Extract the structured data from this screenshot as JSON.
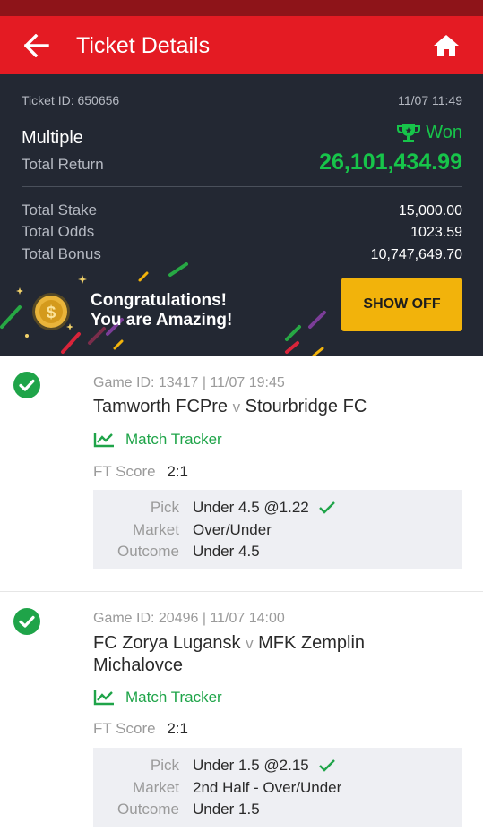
{
  "header": {
    "title": "Ticket Details"
  },
  "ticket": {
    "id_label": "Ticket ID: 650656",
    "datetime": "11/07 11:49",
    "bet_type": "Multiple",
    "status": "Won",
    "total_return_label": "Total Return",
    "total_return": "26,101,434.99",
    "stats": [
      {
        "label": "Total Stake",
        "value": "15,000.00"
      },
      {
        "label": "Total Odds",
        "value": "1023.59"
      },
      {
        "label": "Total Bonus",
        "value": "10,747,649.70"
      }
    ]
  },
  "banner": {
    "line1": "Congratulations!",
    "line2": "You are Amazing!",
    "button_label": "SHOW OFF"
  },
  "games": [
    {
      "meta": "Game ID: 13417 | 11/07 19:45",
      "home": "Tamworth FCPre",
      "vs": "v",
      "away": "Stourbridge FC",
      "tracker_label": "Match Tracker",
      "ft_label": "FT Score",
      "ft_value": "2:1",
      "pick_label": "Pick",
      "pick_value": "Under 4.5 @1.22",
      "market_label": "Market",
      "market_value": "Over/Under",
      "outcome_label": "Outcome",
      "outcome_value": "Under 4.5"
    },
    {
      "meta": "Game ID: 20496 | 11/07 14:00",
      "home": "FC Zorya Lugansk",
      "vs": "v",
      "away": "MFK Zemplin Michalovce",
      "tracker_label": "Match Tracker",
      "ft_label": "FT Score",
      "ft_value": "2:1",
      "pick_label": "Pick",
      "pick_value": "Under 1.5 @2.15",
      "market_label": "Market",
      "market_value": "2nd Half - Over/Under",
      "outcome_label": "Outcome",
      "outcome_value": "Under 1.5"
    }
  ],
  "colors": {
    "brand_red": "#e41b23",
    "win_green": "#17c44a",
    "button_yellow": "#f2b30b",
    "dark_panel": "#232833"
  },
  "icons": [
    "back-arrow-icon",
    "home-icon",
    "trophy-icon",
    "coin-icon",
    "check-circle-icon",
    "chart-icon",
    "checkmark-icon"
  ]
}
